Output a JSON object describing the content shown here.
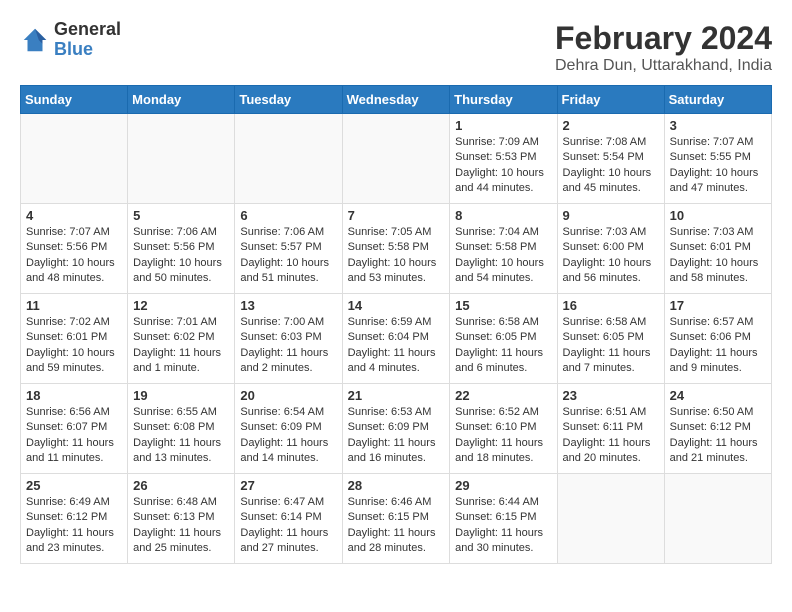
{
  "header": {
    "logo_line1": "General",
    "logo_line2": "Blue",
    "month": "February 2024",
    "location": "Dehra Dun, Uttarakhand, India"
  },
  "days_of_week": [
    "Sunday",
    "Monday",
    "Tuesday",
    "Wednesday",
    "Thursday",
    "Friday",
    "Saturday"
  ],
  "weeks": [
    [
      {
        "num": "",
        "info": ""
      },
      {
        "num": "",
        "info": ""
      },
      {
        "num": "",
        "info": ""
      },
      {
        "num": "",
        "info": ""
      },
      {
        "num": "1",
        "info": "Sunrise: 7:09 AM\nSunset: 5:53 PM\nDaylight: 10 hours\nand 44 minutes."
      },
      {
        "num": "2",
        "info": "Sunrise: 7:08 AM\nSunset: 5:54 PM\nDaylight: 10 hours\nand 45 minutes."
      },
      {
        "num": "3",
        "info": "Sunrise: 7:07 AM\nSunset: 5:55 PM\nDaylight: 10 hours\nand 47 minutes."
      }
    ],
    [
      {
        "num": "4",
        "info": "Sunrise: 7:07 AM\nSunset: 5:56 PM\nDaylight: 10 hours\nand 48 minutes."
      },
      {
        "num": "5",
        "info": "Sunrise: 7:06 AM\nSunset: 5:56 PM\nDaylight: 10 hours\nand 50 minutes."
      },
      {
        "num": "6",
        "info": "Sunrise: 7:06 AM\nSunset: 5:57 PM\nDaylight: 10 hours\nand 51 minutes."
      },
      {
        "num": "7",
        "info": "Sunrise: 7:05 AM\nSunset: 5:58 PM\nDaylight: 10 hours\nand 53 minutes."
      },
      {
        "num": "8",
        "info": "Sunrise: 7:04 AM\nSunset: 5:58 PM\nDaylight: 10 hours\nand 54 minutes."
      },
      {
        "num": "9",
        "info": "Sunrise: 7:03 AM\nSunset: 6:00 PM\nDaylight: 10 hours\nand 56 minutes."
      },
      {
        "num": "10",
        "info": "Sunrise: 7:03 AM\nSunset: 6:01 PM\nDaylight: 10 hours\nand 58 minutes."
      }
    ],
    [
      {
        "num": "11",
        "info": "Sunrise: 7:02 AM\nSunset: 6:01 PM\nDaylight: 10 hours\nand 59 minutes."
      },
      {
        "num": "12",
        "info": "Sunrise: 7:01 AM\nSunset: 6:02 PM\nDaylight: 11 hours\nand 1 minute."
      },
      {
        "num": "13",
        "info": "Sunrise: 7:00 AM\nSunset: 6:03 PM\nDaylight: 11 hours\nand 2 minutes."
      },
      {
        "num": "14",
        "info": "Sunrise: 6:59 AM\nSunset: 6:04 PM\nDaylight: 11 hours\nand 4 minutes."
      },
      {
        "num": "15",
        "info": "Sunrise: 6:58 AM\nSunset: 6:05 PM\nDaylight: 11 hours\nand 6 minutes."
      },
      {
        "num": "16",
        "info": "Sunrise: 6:58 AM\nSunset: 6:05 PM\nDaylight: 11 hours\nand 7 minutes."
      },
      {
        "num": "17",
        "info": "Sunrise: 6:57 AM\nSunset: 6:06 PM\nDaylight: 11 hours\nand 9 minutes."
      }
    ],
    [
      {
        "num": "18",
        "info": "Sunrise: 6:56 AM\nSunset: 6:07 PM\nDaylight: 11 hours\nand 11 minutes."
      },
      {
        "num": "19",
        "info": "Sunrise: 6:55 AM\nSunset: 6:08 PM\nDaylight: 11 hours\nand 13 minutes."
      },
      {
        "num": "20",
        "info": "Sunrise: 6:54 AM\nSunset: 6:09 PM\nDaylight: 11 hours\nand 14 minutes."
      },
      {
        "num": "21",
        "info": "Sunrise: 6:53 AM\nSunset: 6:09 PM\nDaylight: 11 hours\nand 16 minutes."
      },
      {
        "num": "22",
        "info": "Sunrise: 6:52 AM\nSunset: 6:10 PM\nDaylight: 11 hours\nand 18 minutes."
      },
      {
        "num": "23",
        "info": "Sunrise: 6:51 AM\nSunset: 6:11 PM\nDaylight: 11 hours\nand 20 minutes."
      },
      {
        "num": "24",
        "info": "Sunrise: 6:50 AM\nSunset: 6:12 PM\nDaylight: 11 hours\nand 21 minutes."
      }
    ],
    [
      {
        "num": "25",
        "info": "Sunrise: 6:49 AM\nSunset: 6:12 PM\nDaylight: 11 hours\nand 23 minutes."
      },
      {
        "num": "26",
        "info": "Sunrise: 6:48 AM\nSunset: 6:13 PM\nDaylight: 11 hours\nand 25 minutes."
      },
      {
        "num": "27",
        "info": "Sunrise: 6:47 AM\nSunset: 6:14 PM\nDaylight: 11 hours\nand 27 minutes."
      },
      {
        "num": "28",
        "info": "Sunrise: 6:46 AM\nSunset: 6:15 PM\nDaylight: 11 hours\nand 28 minutes."
      },
      {
        "num": "29",
        "info": "Sunrise: 6:44 AM\nSunset: 6:15 PM\nDaylight: 11 hours\nand 30 minutes."
      },
      {
        "num": "",
        "info": ""
      },
      {
        "num": "",
        "info": ""
      }
    ]
  ]
}
